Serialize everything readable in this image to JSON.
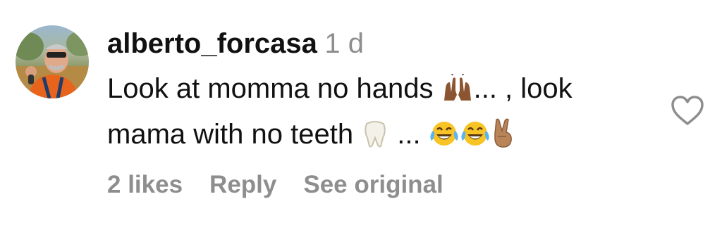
{
  "comment": {
    "username": "alberto_forcasa",
    "timestamp": "1 d",
    "text": {
      "line1_before": "Look at momma no hands ",
      "line1_after": "... , look",
      "line2_before": "mama with no teeth ",
      "line2_after": " ... "
    },
    "emojis": [
      "raising-hands-emoji",
      "tooth-emoji",
      "tears-of-joy-emoji",
      "tears-of-joy-emoji",
      "victory-hand-emoji"
    ],
    "actions": {
      "likes": "2 likes",
      "reply": "Reply",
      "see_original": "See original"
    },
    "like_icon": "heart-outline-icon"
  },
  "colors": {
    "text": "#111111",
    "muted": "#8e8e8e",
    "background": "#ffffff"
  }
}
